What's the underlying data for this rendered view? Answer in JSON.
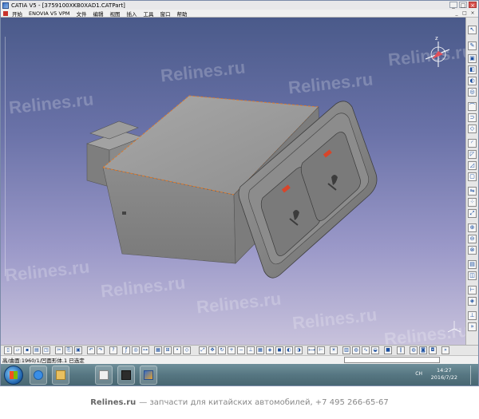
{
  "window": {
    "title": "CATIA V5 - [3759100XKB0XAD1.CATPart]",
    "controls": [
      "_",
      "□",
      "×"
    ]
  },
  "menubar": {
    "items": [
      "开始",
      "ENOVIA V5 VPM",
      "文件",
      "编辑",
      "视图",
      "插入",
      "工具",
      "窗口",
      "帮助"
    ],
    "doc_controls": [
      "_",
      "□",
      "×"
    ]
  },
  "viewport": {
    "compass_icon": "compass-icon",
    "axis_icon": "axis-triad-icon"
  },
  "statusbar": {
    "message": "高/曲面:1960/1/凹面形体.1 已选定",
    "command_placeholder": ""
  },
  "taskbar": {
    "time": "14:27",
    "date": "2016/7/22",
    "tray_label": "CH"
  },
  "watermark": {
    "text": "Relines.ru"
  },
  "footer": {
    "brand": "Relines.ru",
    "text": "— запчасти для китайских автомобилей, +7 495 266-65-67"
  },
  "colors": {
    "viewport_top": "#4a5a8a",
    "viewport_bottom": "#c8c2dc",
    "part_gray": "#8a8a8a",
    "selection_orange": "#e07a2a",
    "indicator_red": "#d8452a"
  }
}
